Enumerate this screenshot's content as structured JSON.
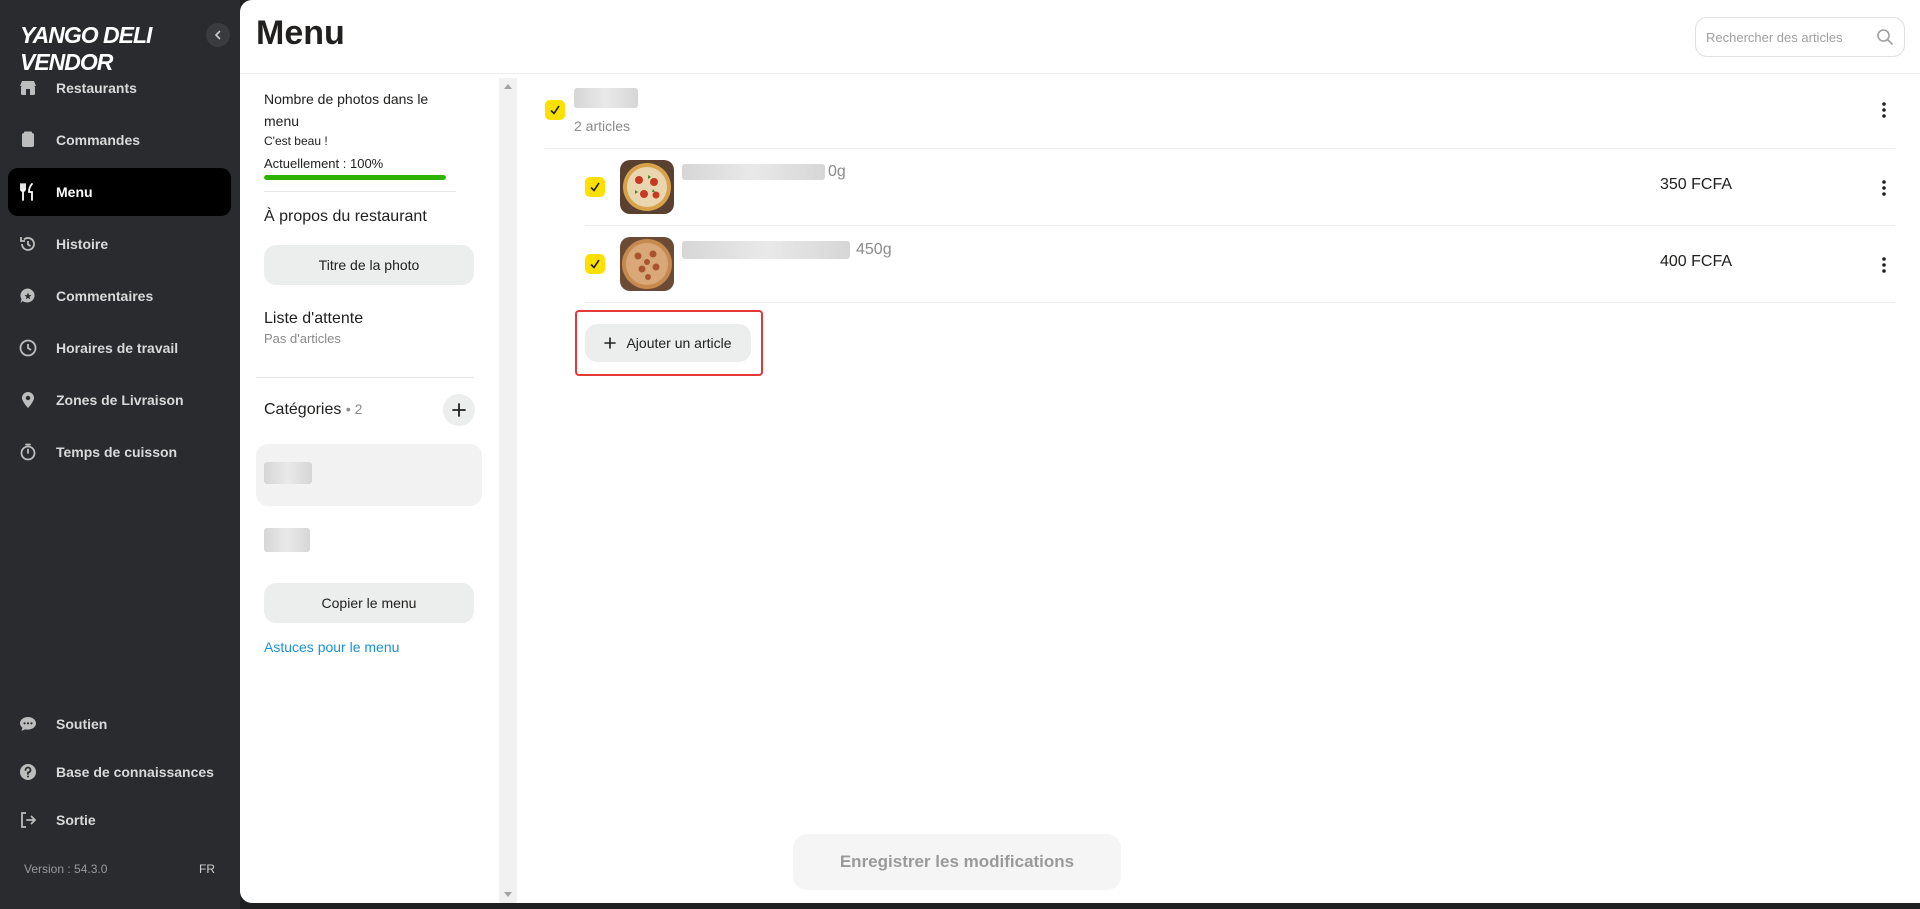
{
  "app": {
    "logo": "YANGO DELI VENDOR",
    "version": "Version : 54.3.0",
    "lang": "FR"
  },
  "sidebar": {
    "items": [
      {
        "label": "Restaurants",
        "icon": "store-icon"
      },
      {
        "label": "Commandes",
        "icon": "orders-icon"
      },
      {
        "label": "Menu",
        "icon": "fork-knife-icon",
        "active": true
      },
      {
        "label": "Histoire",
        "icon": "history-icon"
      },
      {
        "label": "Commentaires",
        "icon": "comment-icon"
      },
      {
        "label": "Horaires de travail",
        "icon": "clock-icon"
      },
      {
        "label": "Zones de Livraison",
        "icon": "location-pin-icon"
      },
      {
        "label": "Temps de cuisson",
        "icon": "timer-icon"
      }
    ],
    "bottom": [
      {
        "label": "Soutien",
        "icon": "chat-icon"
      },
      {
        "label": "Base de connaissances",
        "icon": "help-icon"
      },
      {
        "label": "Sortie",
        "icon": "logout-icon"
      }
    ]
  },
  "header": {
    "title": "Menu",
    "search_placeholder": "Rechercher des articles"
  },
  "panel": {
    "photos_title": "Nombre de photos dans le menu",
    "photos_note": "C'est beau !",
    "photos_current": "Actuellement : 100%",
    "photos_progress": 1.0,
    "about_title": "À propos du restaurant",
    "photo_title_button": "Titre de la photo",
    "waitlist_title": "Liste d'attente",
    "waitlist_sub": "Pas d'articles",
    "categories_label": "Catégories",
    "categories_count": "• 2",
    "copy_menu_button": "Copier le menu",
    "tips_link": "Astuces pour le menu"
  },
  "category": {
    "count_label": "2 articles",
    "items": [
      {
        "name_suffix": "0g",
        "price": "350 FCFA"
      },
      {
        "name_suffix": "450g",
        "price": "400 FCFA"
      }
    ]
  },
  "actions": {
    "add_article": "Ajouter un article",
    "save": "Enregistrer les modifications"
  },
  "colors": {
    "accent": "#fce000",
    "sidebar_bg": "#2a2b2e",
    "progress": "#2db400",
    "link": "#1a91d6",
    "highlight": "#e53935"
  }
}
